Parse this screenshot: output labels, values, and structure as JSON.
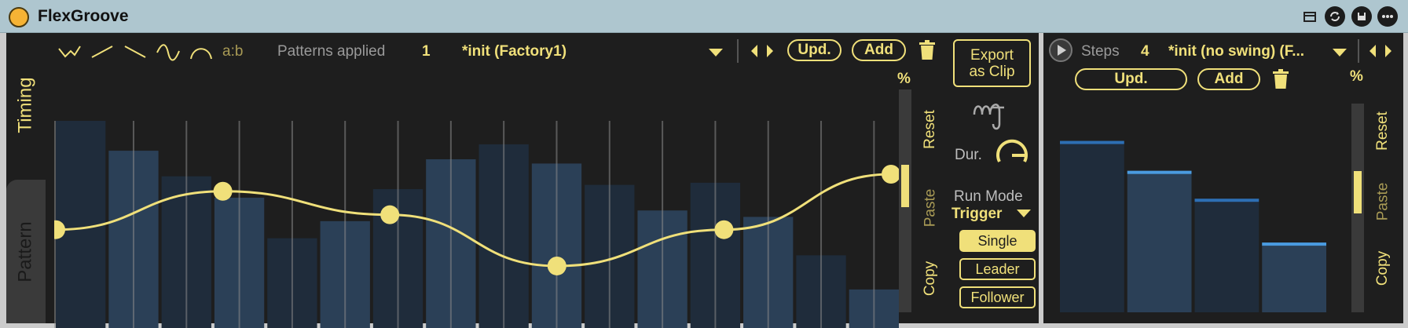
{
  "window": {
    "title": "FlexGroove"
  },
  "title_icons": [
    "clip-icon",
    "hotswap-icon",
    "save-icon",
    "more-icon"
  ],
  "tabs": {
    "timing": "Timing",
    "pattern": "Pattern"
  },
  "toolbar": {
    "curve_icons": [
      "zigzag-curve-icon",
      "rising-curve-icon",
      "falling-curve-icon",
      "sine-curve-icon",
      "arc-curve-icon"
    ],
    "ratio_label": "a:b",
    "patterns_applied_label": "Patterns applied",
    "patterns_applied_value": "1",
    "preset_name": "*init (Factory1)",
    "update_label": "Upd.",
    "add_label": "Add"
  },
  "side_controls": {
    "percent_label": "%",
    "reset_label": "Reset",
    "paste_label": "Paste",
    "copy_label": "Copy",
    "level": 0.2
  },
  "export_label_line1": "Export",
  "export_label_line2": "as Clip",
  "duration_label": "Dur.",
  "run_mode": {
    "label": "Run Mode",
    "value": "Trigger"
  },
  "modes": [
    {
      "label": "Single",
      "active": true
    },
    {
      "label": "Leader",
      "active": false
    },
    {
      "label": "Follower",
      "active": false
    }
  ],
  "timing_grid": {
    "bars": [
      1.0,
      0.86,
      0.74,
      0.64,
      0.45,
      0.53,
      0.68,
      0.82,
      0.89,
      0.8,
      0.7,
      0.58,
      0.71,
      0.55,
      0.37,
      0.21
    ],
    "curve_points": [
      0.49,
      0.67,
      0.56,
      0.32,
      0.49,
      0.75
    ],
    "progress": 0.54,
    "colors": {
      "accent": "#f0e07a",
      "bar_dark": "#1f2c3b",
      "bar_light": "#2b4057"
    }
  },
  "steps_panel": {
    "steps_label": "Steps",
    "steps_value": "4",
    "preset_name": "*init (no swing) (F...",
    "update_label": "Upd.",
    "add_label": "Add",
    "percent_label": "%",
    "reset_label": "Reset",
    "paste_label": "Paste",
    "copy_label": "Copy",
    "bars": [
      0.86,
      0.71,
      0.57,
      0.35
    ],
    "level": 0.22
  }
}
